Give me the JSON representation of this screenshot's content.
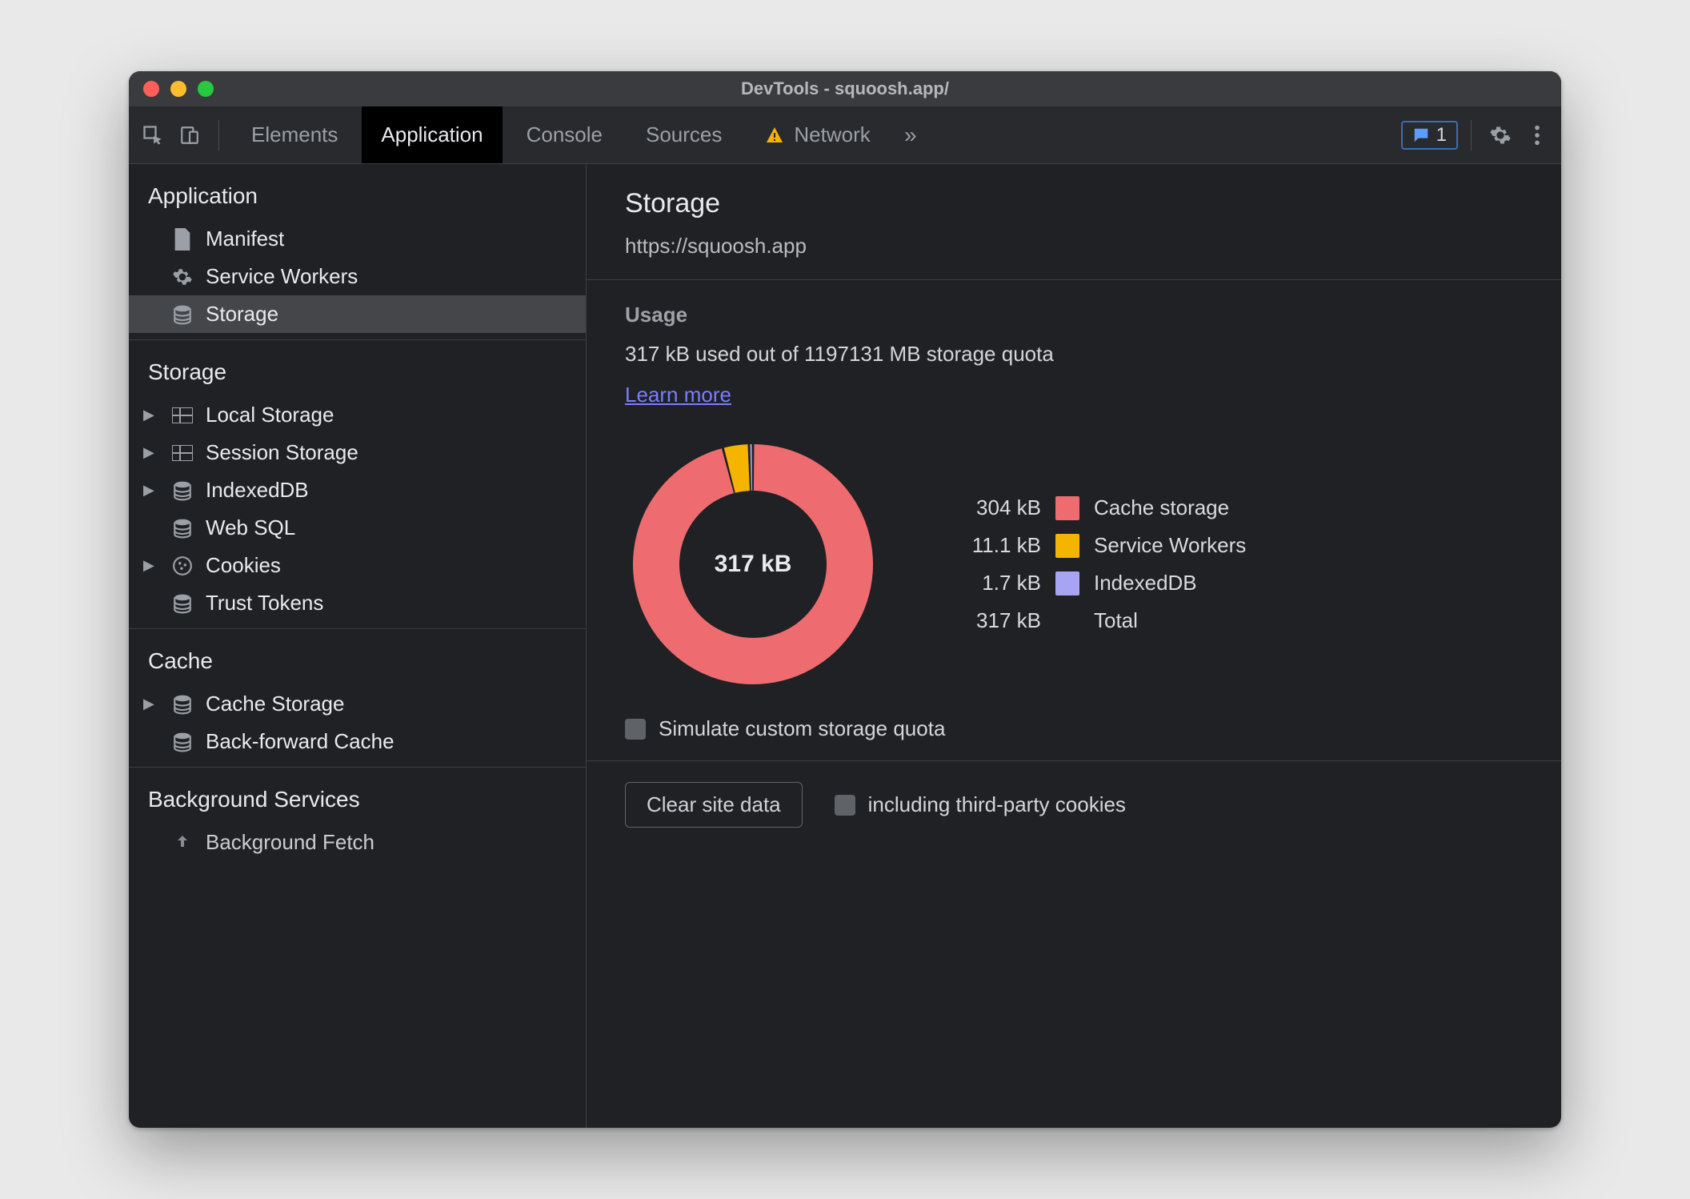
{
  "window": {
    "title": "DevTools - squoosh.app/"
  },
  "tabs": {
    "elements": "Elements",
    "application": "Application",
    "console": "Console",
    "sources": "Sources",
    "network": "Network",
    "issues_count": "1"
  },
  "sidebar": {
    "sections": {
      "application": {
        "title": "Application",
        "manifest": "Manifest",
        "service_workers": "Service Workers",
        "storage": "Storage"
      },
      "storage": {
        "title": "Storage",
        "local_storage": "Local Storage",
        "session_storage": "Session Storage",
        "indexeddb": "IndexedDB",
        "web_sql": "Web SQL",
        "cookies": "Cookies",
        "trust_tokens": "Trust Tokens"
      },
      "cache": {
        "title": "Cache",
        "cache_storage": "Cache Storage",
        "bf_cache": "Back-forward Cache"
      },
      "background": {
        "title": "Background Services",
        "background_fetch": "Background Fetch"
      }
    }
  },
  "panel": {
    "title": "Storage",
    "origin": "https://squoosh.app",
    "usage_heading": "Usage",
    "usage_line": "317 kB used out of 1197131 MB storage quota",
    "learn_more": "Learn more",
    "center_label": "317 kB",
    "simulate_label": "Simulate custom storage quota",
    "clear_button": "Clear site data",
    "third_party_label": "including third-party cookies"
  },
  "legend": {
    "cache": {
      "size": "304 kB",
      "label": "Cache storage",
      "color": "#ee6c6f"
    },
    "sw": {
      "size": "11.1 kB",
      "label": "Service Workers",
      "color": "#f4b400"
    },
    "idb": {
      "size": "1.7 kB",
      "label": "IndexedDB",
      "color": "#a6a4f3"
    },
    "total": {
      "size": "317 kB",
      "label": "Total"
    }
  },
  "chart_data": {
    "type": "pie",
    "title": "Storage usage breakdown",
    "series": [
      {
        "name": "Cache storage",
        "value": 304,
        "unit": "kB",
        "color": "#ee6c6f"
      },
      {
        "name": "Service Workers",
        "value": 11.1,
        "unit": "kB",
        "color": "#f4b400"
      },
      {
        "name": "IndexedDB",
        "value": 1.7,
        "unit": "kB",
        "color": "#a6a4f3"
      }
    ],
    "total": {
      "value": 317,
      "unit": "kB"
    },
    "donut": true
  }
}
